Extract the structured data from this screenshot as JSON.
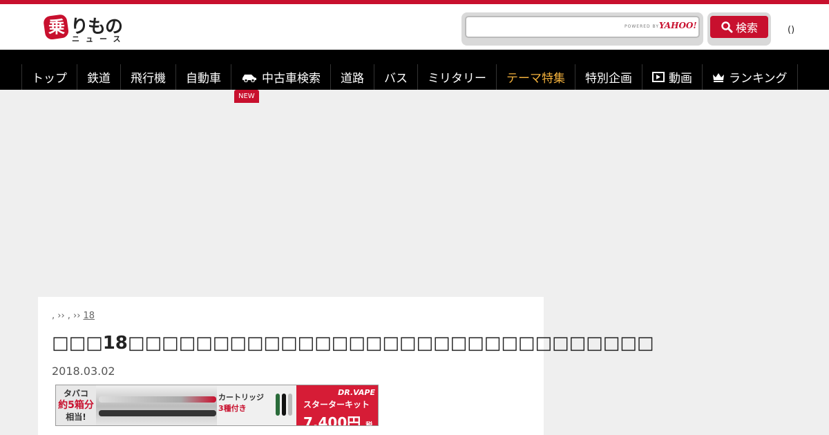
{
  "header": {
    "logo_text_main": "りもの",
    "logo_text_sub": "ニュース",
    "logo_mark_char": "乗",
    "search": {
      "value": "",
      "placeholder": "",
      "powered_by": "POWERED BY",
      "provider": "YAHOO!"
    },
    "search_button_label": "検索",
    "paren_text": "()"
  },
  "nav": {
    "new_badge": "NEW",
    "items": [
      {
        "label": "トップ"
      },
      {
        "label": "鉄道"
      },
      {
        "label": "飛行機"
      },
      {
        "label": "自動車"
      },
      {
        "label": "中古車検索",
        "icon": "car-icon"
      },
      {
        "label": "道路"
      },
      {
        "label": "バス"
      },
      {
        "label": "ミリタリー"
      },
      {
        "label": "テーマ特集",
        "active": true
      },
      {
        "label": "特別企画"
      },
      {
        "label": "動画",
        "icon": "video-icon"
      },
      {
        "label": "ランキング",
        "icon": "crown-icon"
      }
    ]
  },
  "article": {
    "breadcrumb_prefix": ",  ›› ,  ››",
    "breadcrumb_link": "18",
    "title": "□□□18□□□□□□□□□□□□□□□□□□□□□□□□□□□□□□□",
    "date": "2018.03.02"
  },
  "banner": {
    "left_line1": "タバコ",
    "left_line2": "約5箱分",
    "left_line3": "相当!",
    "cart_line1": "カートリッジ",
    "cart_line2": "3種付き",
    "brand": "DR.VAPE",
    "kit": "スターターキット",
    "price": "7,400円",
    "tax": "税別"
  },
  "colors": {
    "brand_red": "#c8102e",
    "nav_bg": "#000000",
    "active_nav": "#f3b13c"
  }
}
